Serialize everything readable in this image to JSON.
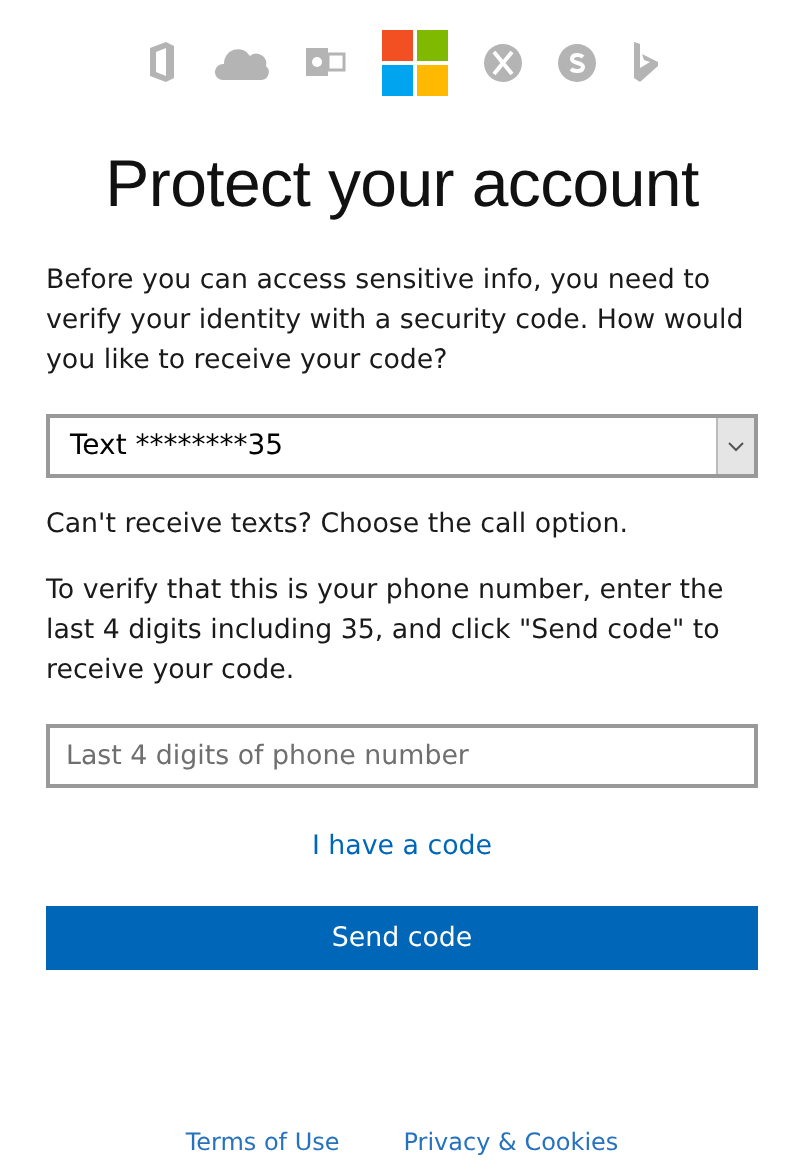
{
  "title": "Protect your account",
  "intro": "Before you can access sensitive info, you need to verify your identity with a security code. How would you like to receive your code?",
  "method_select": {
    "value": "Text ********35"
  },
  "call_hint": "Can't receive texts? Choose the call option.",
  "instructions": "To verify that this is your phone number, enter the last 4 digits including 35, and click \"Send code\" to receive your code.",
  "digits_field": {
    "placeholder": "Last 4 digits of phone number"
  },
  "have_code_link": "I have a code",
  "send_button": "Send code",
  "footer_links": [
    "Terms of Use",
    "Privacy & Cookies"
  ]
}
